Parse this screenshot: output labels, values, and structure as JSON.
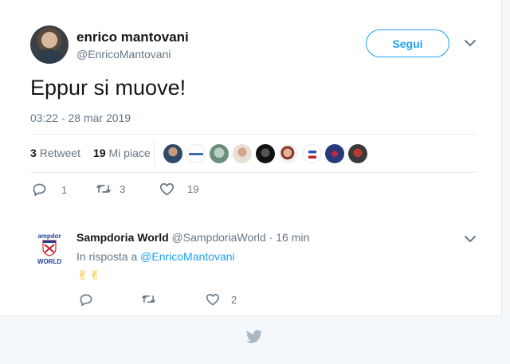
{
  "author": {
    "name": "enrico mantovani",
    "handle": "@EnricoMantovani"
  },
  "follow_label": "Segui",
  "tweet": {
    "text": "Eppur si muove!",
    "timestamp": "03:22 - 28 mar 2019",
    "retweets_count": "3",
    "retweets_label": "Retweet",
    "likes_count": "19",
    "likes_label": "Mi piace",
    "reply_count": "1",
    "retweet_count_action": "3",
    "like_count_action": "19"
  },
  "reply": {
    "name": "Sampdoria World",
    "handle": "@SampdoriaWorld",
    "time": "16 min",
    "separator": "·",
    "in_reply_prefix": "In risposta a",
    "in_reply_handle": "@EnricoMantovani",
    "emoji": "✌✌",
    "like_count": "2"
  },
  "logo_text": {
    "top": "ampdor",
    "bottom": "WORLD"
  },
  "colors": {
    "accent": "#1da1f2",
    "muted": "#657786",
    "text": "#14171a"
  }
}
